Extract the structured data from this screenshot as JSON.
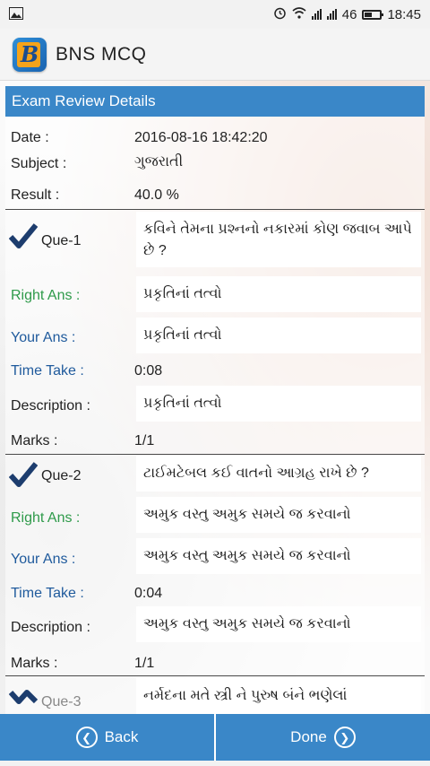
{
  "status_bar": {
    "signal_label": "46",
    "time": "18:45"
  },
  "app": {
    "title": "BNS MCQ",
    "logo_letter": "B"
  },
  "panel": {
    "header": "Exam Review Details",
    "date_label": "Date :",
    "date_value": "2016-08-16 18:42:20",
    "subject_label": "Subject :",
    "subject_value": "ગુજરાતી",
    "result_label": "Result :",
    "result_value": "40.0 %"
  },
  "questions": [
    {
      "que_label": "Que-1",
      "question": "કવિને તેમના પ્રશ્નનો નકારમાં કોણ જવાબ આપે છે ?",
      "right_ans_label": "Right Ans :",
      "right_ans": "પ્રકૃતિનાં તત્વો",
      "your_ans_label": "Your Ans :",
      "your_ans": "પ્રકૃતિનાં તત્વો",
      "time_label": "Time Take :",
      "time_value": "0:08",
      "desc_label": "Description :",
      "desc_value": "પ્રકૃતિનાં તત્વો",
      "marks_label": "Marks :",
      "marks_value": "1/1"
    },
    {
      "que_label": "Que-2",
      "question": "ટાઈમટેબલ કઈ વાતનો આગ્રહ રાખે છે ?",
      "right_ans_label": "Right Ans :",
      "right_ans": "અમુક વસ્તુ અમુક સમયે જ કરવાનો",
      "your_ans_label": "Your Ans :",
      "your_ans": "અમુક વસ્તુ અમુક સમયે જ કરવાનો",
      "time_label": "Time Take :",
      "time_value": "0:04",
      "desc_label": "Description :",
      "desc_value": "અમુક વસ્તુ અમુક સમયે જ કરવાનો",
      "marks_label": "Marks :",
      "marks_value": "1/1"
    },
    {
      "que_label": "Que-3",
      "question": "નર્મદના મતે સ્ત્રી ને પુરુષ બંને ભણેલાં"
    }
  ],
  "buttons": {
    "back": "Back",
    "done": "Done"
  },
  "colors": {
    "header_blue": "#3a87c8",
    "right_green": "#2e9a4a",
    "label_blue": "#1f5a9c",
    "check_navy": "#1d3d6e"
  }
}
